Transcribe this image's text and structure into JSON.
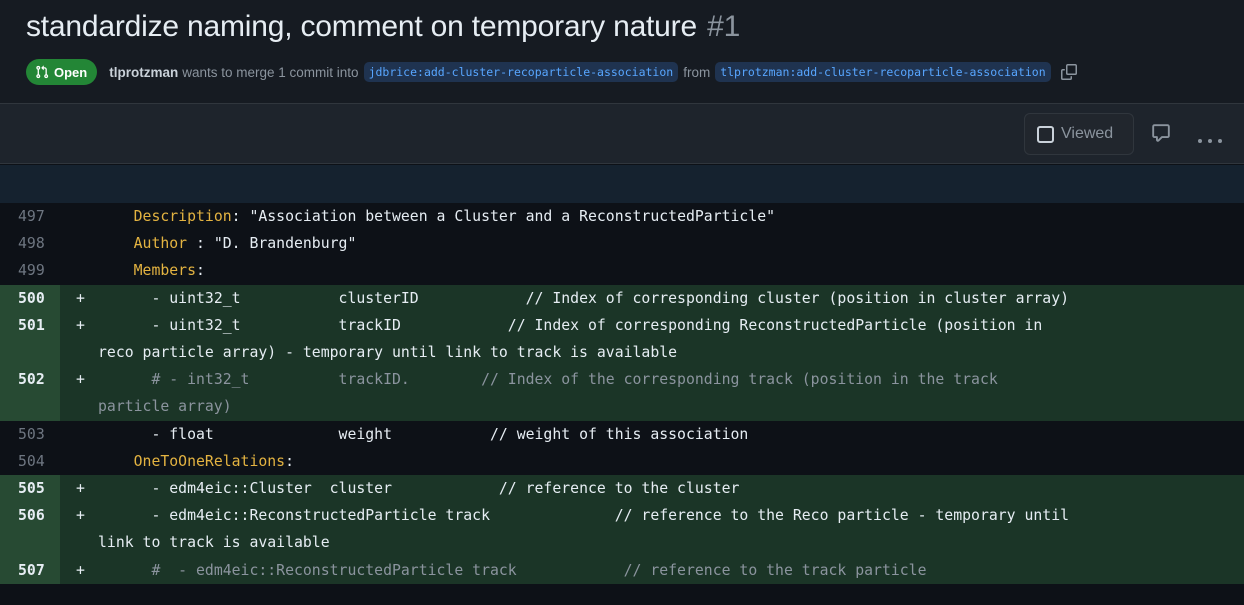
{
  "pr": {
    "title": "standardize naming, comment on temporary nature",
    "number": "#1",
    "state_label": "Open",
    "author": "tlprotzman",
    "merge_text": "wants to merge 1 commit into",
    "base_branch": "jdbrice:add-cluster-recoparticle-association",
    "from_text": "from",
    "head_branch": "tlprotzman:add-cluster-recoparticle-association"
  },
  "file_header": {
    "viewed_label": "Viewed"
  },
  "diff_lines": [
    {
      "n": "497",
      "type": "ctx",
      "marker": "",
      "key": "Description",
      "text": ": \"Association between a Cluster and a ReconstructedParticle\""
    },
    {
      "n": "498",
      "type": "ctx",
      "marker": "",
      "key": "Author",
      "text": " : \"D. Brandenburg\""
    },
    {
      "n": "499",
      "type": "ctx",
      "marker": "",
      "key": "Members",
      "text": ":"
    },
    {
      "n": "500",
      "type": "add",
      "marker": "+",
      "key": "",
      "text": "  - uint32_t           clusterID            // Index of corresponding cluster (position in cluster array)"
    },
    {
      "n": "501",
      "type": "add",
      "marker": "+",
      "key": "",
      "text": "  - uint32_t           trackID            // Index of corresponding ReconstructedParticle (position in"
    },
    {
      "n": "",
      "type": "add",
      "marker": "",
      "key": "",
      "text": "reco particle array) - temporary until link to track is available",
      "cont": true
    },
    {
      "n": "502",
      "type": "add",
      "marker": "+",
      "key": "",
      "text": "  # - int32_t          trackID.        // Index of the corresponding track (position in the track",
      "dim": true
    },
    {
      "n": "",
      "type": "add",
      "marker": "",
      "key": "",
      "text": "particle array)",
      "cont": true,
      "dim": true
    },
    {
      "n": "503",
      "type": "ctx",
      "marker": "",
      "key": "",
      "text": "  - float              weight           // weight of this association"
    },
    {
      "n": "504",
      "type": "ctx",
      "marker": "",
      "key": "OneToOneRelations",
      "text": ":"
    },
    {
      "n": "505",
      "type": "add",
      "marker": "+",
      "key": "",
      "text": "  - edm4eic::Cluster  cluster            // reference to the cluster"
    },
    {
      "n": "506",
      "type": "add",
      "marker": "+",
      "key": "",
      "text": "  - edm4eic::ReconstructedParticle track              // reference to the Reco particle - temporary until"
    },
    {
      "n": "",
      "type": "add",
      "marker": "",
      "key": "",
      "text": "link to track is available",
      "cont": true
    },
    {
      "n": "507",
      "type": "add",
      "marker": "+",
      "key": "",
      "text": "  #  - edm4eic::ReconstructedParticle track            // reference to the track particle",
      "dim": true
    }
  ],
  "icons": {
    "state": "git-pull-request-icon",
    "copy": "copy-icon",
    "comment": "comment-icon",
    "more": "kebab-horizontal-icon"
  },
  "colors": {
    "open_green": "#238636",
    "added_line_bg": "#1b3527",
    "branch_blue": "#58a6ff",
    "key_yellow": "#e3b341"
  }
}
